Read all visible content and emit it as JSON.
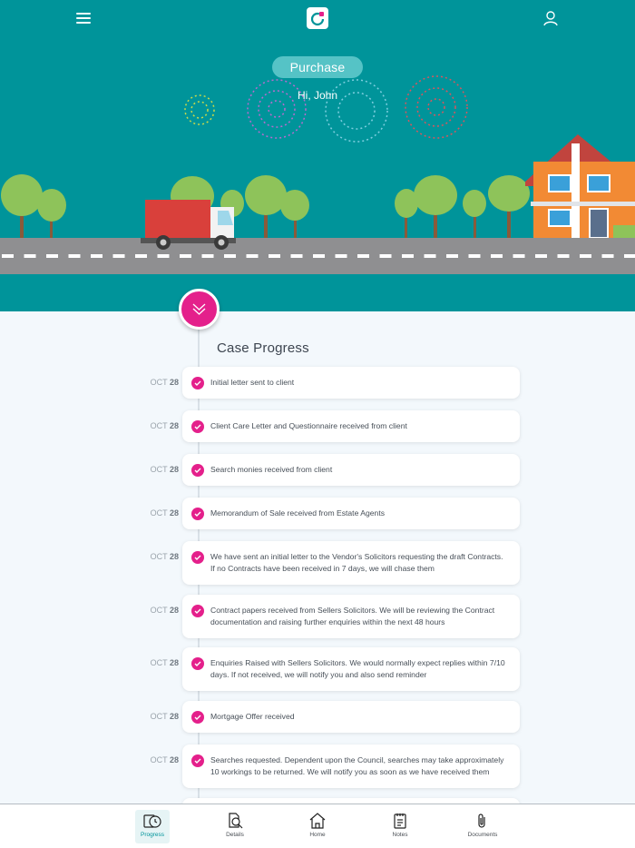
{
  "header": {
    "menu_icon": "hamburger-menu-icon",
    "logo_icon": "app-logo-icon",
    "user_icon": "user-profile-icon",
    "case_type": "Purchase",
    "greeting": "Hi, John"
  },
  "colors": {
    "hero_bg": "#00949a",
    "accent": "#e4208b",
    "page_bg": "#f3f8fc"
  },
  "section_title": "Case Progress",
  "timeline": [
    {
      "month": "OCT",
      "day": "28",
      "text": "Initial letter sent to client"
    },
    {
      "month": "OCT",
      "day": "28",
      "text": "Client Care Letter and Questionnaire received from client"
    },
    {
      "month": "OCT",
      "day": "28",
      "text": "Search monies received from client"
    },
    {
      "month": "OCT",
      "day": "28",
      "text": "Memorandum of Sale received from Estate Agents"
    },
    {
      "month": "OCT",
      "day": "28",
      "text": "We have sent an initial letter to the Vendor's Solicitors requesting the draft Contracts. If no Contracts have been received in 7 days, we will chase them"
    },
    {
      "month": "OCT",
      "day": "28",
      "text": "Contract papers received from Sellers Solicitors. We will be reviewing the Contract documentation and raising further enquiries within the next 48 hours"
    },
    {
      "month": "OCT",
      "day": "28",
      "text": "Enquiries Raised with Sellers Solicitors. We would normally expect replies within 7/10 days. If not received, we will notify you and also send reminder"
    },
    {
      "month": "OCT",
      "day": "28",
      "text": "Mortgage Offer received"
    },
    {
      "month": "OCT",
      "day": "28",
      "text": "Searches requested. Dependent upon the Council, searches may take approximately 10 workings to be returned. We will notify you as soon as we have received them"
    }
  ],
  "bottom_nav": [
    {
      "label": "Progress",
      "icon": "progress-clock-icon",
      "active": true
    },
    {
      "label": "Details",
      "icon": "details-search-icon",
      "active": false
    },
    {
      "label": "Home",
      "icon": "home-icon",
      "active": false
    },
    {
      "label": "Notes",
      "icon": "notes-icon",
      "active": false
    },
    {
      "label": "Documents",
      "icon": "paperclip-icon",
      "active": false
    }
  ]
}
